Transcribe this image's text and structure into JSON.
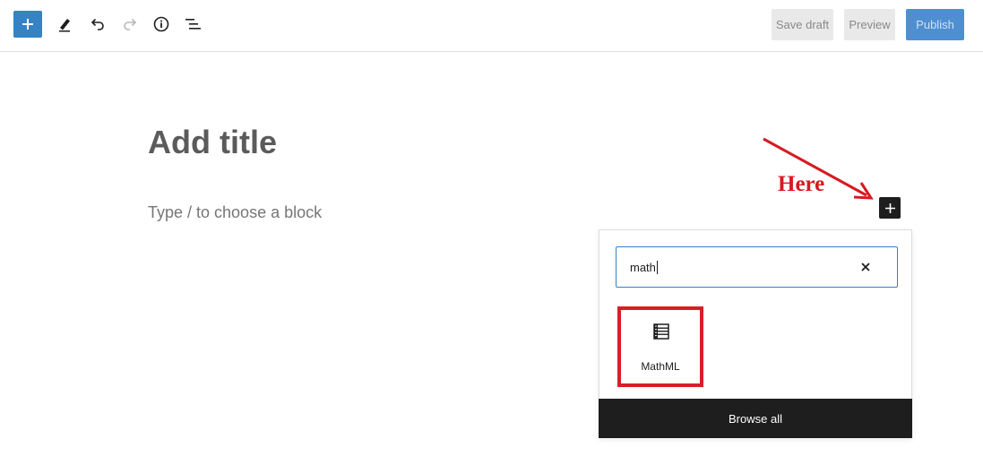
{
  "toolbar": {
    "inserter_icon": "plus-icon",
    "tools": [
      "pencil-icon",
      "undo-icon",
      "redo-icon",
      "info-icon",
      "list-view-icon"
    ],
    "save_draft_label": "Save draft",
    "preview_label": "Preview",
    "publish_label": "Publish",
    "accent_color": "#3582c4"
  },
  "editor": {
    "title_placeholder": "Add title",
    "block_placeholder": "Type / to choose a block"
  },
  "annotation": {
    "text": "Here",
    "color": "#d71920"
  },
  "inserter": {
    "search_value": "math",
    "results": [
      {
        "label": "MathML",
        "icon": "table-list-icon"
      }
    ],
    "browse_all_label": "Browse all"
  }
}
